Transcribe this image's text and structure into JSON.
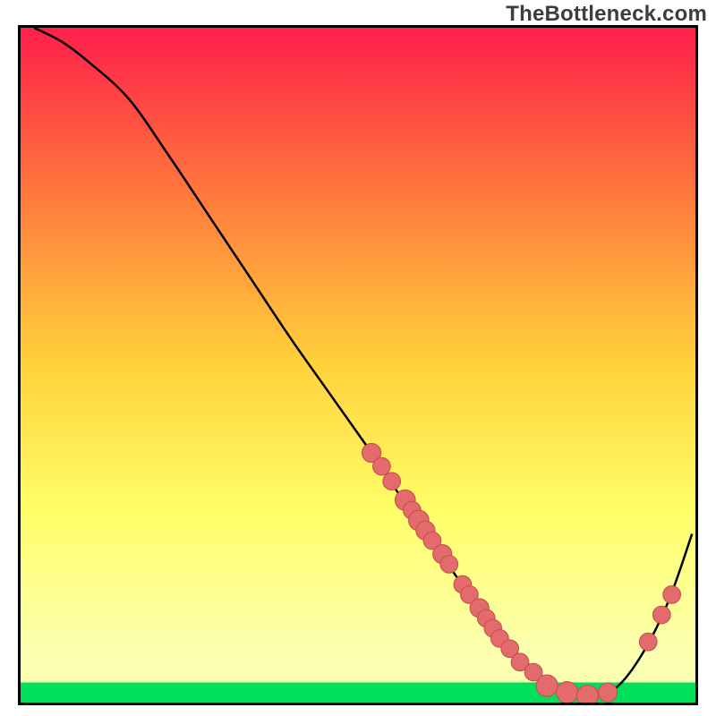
{
  "watermark": "TheBottleneck.com",
  "colors": {
    "top": "#ff1f4b",
    "mid_upper": "#ff7a3c",
    "mid": "#ffd23c",
    "mid_lower": "#ffff6a",
    "lower": "#fbffb0",
    "bottom_band": "#00e05a",
    "border": "#000000",
    "curve": "#000000",
    "marker_fill": "#e46b6b",
    "marker_stroke": "#c94f4f"
  },
  "chart_data": {
    "type": "line",
    "title": "",
    "xlabel": "",
    "ylabel": "",
    "xlim": [
      0,
      100
    ],
    "ylim": [
      0,
      100
    ],
    "grid": false,
    "legend": false,
    "notes": "V-shaped bottleneck curve. x and y are percentages of the square plot (0 = left/bottom, 100 = right/top). No axis ticks or labels are shown in the original image.",
    "series": [
      {
        "name": "bottleneck-curve",
        "x": [
          2,
          6,
          10,
          16,
          22,
          28,
          34,
          40,
          46,
          52,
          56,
          60,
          64,
          68,
          72,
          76,
          80,
          84,
          88,
          92,
          96,
          99.5
        ],
        "y": [
          100,
          98,
          95,
          89.5,
          81,
          72,
          63,
          54,
          45.5,
          37,
          31,
          25,
          19.5,
          14,
          9,
          5,
          2,
          1,
          2,
          7,
          15,
          25
        ]
      }
    ],
    "markers": [
      {
        "x": 52.0,
        "y": 37.0,
        "r": 1.4
      },
      {
        "x": 53.5,
        "y": 35.0,
        "r": 1.3
      },
      {
        "x": 55.0,
        "y": 32.8,
        "r": 1.3
      },
      {
        "x": 57.0,
        "y": 30.0,
        "r": 1.5
      },
      {
        "x": 58.0,
        "y": 28.5,
        "r": 1.3
      },
      {
        "x": 59.0,
        "y": 27.0,
        "r": 1.5
      },
      {
        "x": 60.0,
        "y": 25.5,
        "r": 1.4
      },
      {
        "x": 61.0,
        "y": 24.0,
        "r": 1.3
      },
      {
        "x": 62.5,
        "y": 22.0,
        "r": 1.4
      },
      {
        "x": 63.5,
        "y": 20.5,
        "r": 1.3
      },
      {
        "x": 65.5,
        "y": 17.5,
        "r": 1.3
      },
      {
        "x": 66.5,
        "y": 16.0,
        "r": 1.3
      },
      {
        "x": 68.0,
        "y": 14.0,
        "r": 1.4
      },
      {
        "x": 69.0,
        "y": 12.5,
        "r": 1.3
      },
      {
        "x": 70.0,
        "y": 11.0,
        "r": 1.3
      },
      {
        "x": 71.0,
        "y": 9.5,
        "r": 1.3
      },
      {
        "x": 72.5,
        "y": 8.0,
        "r": 1.3
      },
      {
        "x": 74.0,
        "y": 6.0,
        "r": 1.3
      },
      {
        "x": 76.0,
        "y": 4.5,
        "r": 1.3
      },
      {
        "x": 78.0,
        "y": 2.5,
        "r": 1.6
      },
      {
        "x": 81.0,
        "y": 1.5,
        "r": 1.6
      },
      {
        "x": 84.0,
        "y": 1.0,
        "r": 1.6
      },
      {
        "x": 87.0,
        "y": 1.5,
        "r": 1.4
      },
      {
        "x": 93.0,
        "y": 9.0,
        "r": 1.3
      },
      {
        "x": 95.0,
        "y": 13.0,
        "r": 1.3
      },
      {
        "x": 96.5,
        "y": 16.0,
        "r": 1.3
      }
    ]
  }
}
